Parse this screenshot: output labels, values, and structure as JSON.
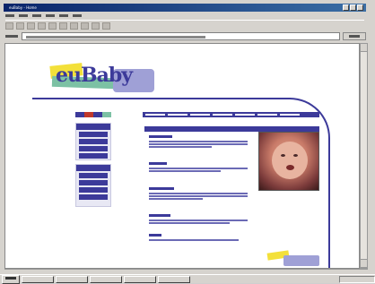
{
  "colors": {
    "brand": "#3c3a9a",
    "titlebar": "#0a246a",
    "yellow": "#f3e03a",
    "green": "#7cc1a4",
    "lavender": "#9fa0d6"
  },
  "window": {
    "title": "euBaby - Home"
  },
  "logo": {
    "text": "euBaby"
  },
  "nav": {
    "colors": [
      "#3c3a9a",
      "#c0392b",
      "#3c3a9a",
      "#7cc1a4"
    ]
  },
  "sidebar": {
    "boxes": [
      {
        "items": [
          "",
          "",
          "",
          ""
        ]
      },
      {
        "items": [
          "",
          "",
          "",
          ""
        ]
      }
    ]
  },
  "articles": [
    {},
    {},
    {},
    {},
    {}
  ]
}
